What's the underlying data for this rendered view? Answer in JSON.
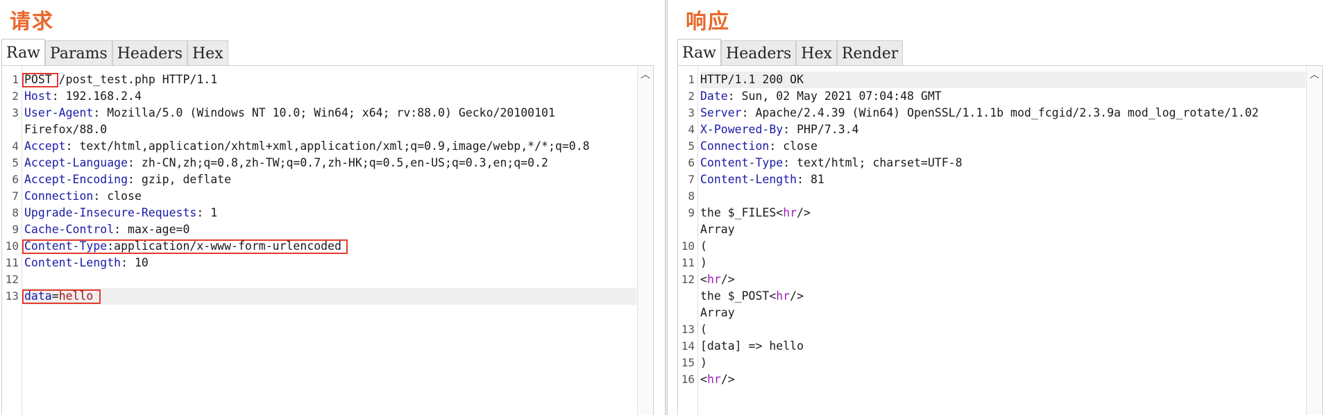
{
  "request": {
    "title": "请求",
    "tabs": [
      "Raw",
      "Params",
      "Headers",
      "Hex"
    ],
    "active_tab": "Raw",
    "lines": [
      {
        "num": "1",
        "parts": [
          {
            "t": "POST",
            "c": ""
          },
          {
            "t": " /post_test.php HTTP/1.1",
            "c": ""
          }
        ]
      },
      {
        "num": "2",
        "parts": [
          {
            "t": "Host",
            "c": "k"
          },
          {
            "t": ": 192.168.2.4",
            "c": ""
          }
        ]
      },
      {
        "num": "3",
        "parts": [
          {
            "t": "User-Agent",
            "c": "k"
          },
          {
            "t": ": Mozilla/5.0 (Windows NT 10.0; Win64; x64; rv:88.0) Gecko/20100101",
            "c": ""
          }
        ]
      },
      {
        "num": "",
        "parts": [
          {
            "t": "Firefox/88.0",
            "c": ""
          }
        ]
      },
      {
        "num": "4",
        "parts": [
          {
            "t": "Accept",
            "c": "k"
          },
          {
            "t": ": text/html,application/xhtml+xml,application/xml;q=0.9,image/webp,*/*;q=0.8",
            "c": ""
          }
        ]
      },
      {
        "num": "5",
        "parts": [
          {
            "t": "Accept-Language",
            "c": "k"
          },
          {
            "t": ": zh-CN,zh;q=0.8,zh-TW;q=0.7,zh-HK;q=0.5,en-US;q=0.3,en;q=0.2",
            "c": ""
          }
        ]
      },
      {
        "num": "6",
        "parts": [
          {
            "t": "Accept-Encoding",
            "c": "k"
          },
          {
            "t": ": gzip, deflate",
            "c": ""
          }
        ]
      },
      {
        "num": "7",
        "parts": [
          {
            "t": "Connection",
            "c": "k"
          },
          {
            "t": ": close",
            "c": ""
          }
        ]
      },
      {
        "num": "8",
        "parts": [
          {
            "t": "Upgrade-Insecure-Requests",
            "c": "k"
          },
          {
            "t": ": 1",
            "c": ""
          }
        ]
      },
      {
        "num": "9",
        "parts": [
          {
            "t": "Cache-Control",
            "c": "k"
          },
          {
            "t": ": max-age=0",
            "c": ""
          }
        ]
      },
      {
        "num": "10",
        "parts": [
          {
            "t": "Content-Type",
            "c": "k"
          },
          {
            "t": ":application/x-www-form-urlencoded",
            "c": ""
          }
        ]
      },
      {
        "num": "11",
        "parts": [
          {
            "t": "Content-Length",
            "c": "k"
          },
          {
            "t": ": 10",
            "c": ""
          }
        ]
      },
      {
        "num": "12",
        "parts": []
      },
      {
        "num": "13",
        "parts": [
          {
            "t": "data",
            "c": "k"
          },
          {
            "t": "=",
            "c": ""
          },
          {
            "t": "hello",
            "c": "v"
          }
        ],
        "highlight": true
      }
    ]
  },
  "response": {
    "title": "响应",
    "tabs": [
      "Raw",
      "Headers",
      "Hex",
      "Render"
    ],
    "active_tab": "Raw",
    "lines": [
      {
        "num": "1",
        "parts": [
          {
            "t": "HTTP/1.1 200 OK",
            "c": ""
          }
        ],
        "highlight": true
      },
      {
        "num": "2",
        "parts": [
          {
            "t": "Date",
            "c": "k"
          },
          {
            "t": ": Sun, 02 May 2021 07:04:48 GMT",
            "c": ""
          }
        ]
      },
      {
        "num": "3",
        "parts": [
          {
            "t": "Server",
            "c": "k"
          },
          {
            "t": ": Apache/2.4.39 (Win64) OpenSSL/1.1.1b mod_fcgid/2.3.9a mod_log_rotate/1.02",
            "c": ""
          }
        ]
      },
      {
        "num": "4",
        "parts": [
          {
            "t": "X-Powered-By",
            "c": "k"
          },
          {
            "t": ": PHP/7.3.4",
            "c": ""
          }
        ]
      },
      {
        "num": "5",
        "parts": [
          {
            "t": "Connection",
            "c": "k"
          },
          {
            "t": ": close",
            "c": ""
          }
        ]
      },
      {
        "num": "6",
        "parts": [
          {
            "t": "Content-Type",
            "c": "k"
          },
          {
            "t": ": text/html; charset=UTF-8",
            "c": ""
          }
        ]
      },
      {
        "num": "7",
        "parts": [
          {
            "t": "Content-Length",
            "c": "k"
          },
          {
            "t": ": 81",
            "c": ""
          }
        ]
      },
      {
        "num": "8",
        "parts": []
      },
      {
        "num": "9",
        "parts": [
          {
            "t": "the $_FILES<",
            "c": ""
          },
          {
            "t": "hr",
            "c": "tag"
          },
          {
            "t": "/>",
            "c": ""
          }
        ]
      },
      {
        "num": "",
        "parts": [
          {
            "t": "Array",
            "c": ""
          }
        ]
      },
      {
        "num": "10",
        "parts": [
          {
            "t": "(",
            "c": ""
          }
        ]
      },
      {
        "num": "11",
        "parts": [
          {
            "t": ")",
            "c": ""
          }
        ]
      },
      {
        "num": "12",
        "parts": [
          {
            "t": "<",
            "c": ""
          },
          {
            "t": "hr",
            "c": "tag"
          },
          {
            "t": "/>",
            "c": ""
          }
        ]
      },
      {
        "num": "",
        "parts": [
          {
            "t": "the $_POST<",
            "c": ""
          },
          {
            "t": "hr",
            "c": "tag"
          },
          {
            "t": "/>",
            "c": ""
          }
        ]
      },
      {
        "num": "",
        "parts": [
          {
            "t": "Array",
            "c": ""
          }
        ]
      },
      {
        "num": "13",
        "parts": [
          {
            "t": "(",
            "c": ""
          }
        ]
      },
      {
        "num": "14",
        "parts": [
          {
            "t": "[data] => hello",
            "c": ""
          }
        ]
      },
      {
        "num": "15",
        "parts": [
          {
            "t": ")",
            "c": ""
          }
        ]
      },
      {
        "num": "16",
        "parts": [
          {
            "t": "<",
            "c": ""
          },
          {
            "t": "hr",
            "c": "tag"
          },
          {
            "t": "/>",
            "c": ""
          }
        ]
      }
    ]
  },
  "colors": {
    "title": "#e8682b",
    "key": "#1a1aa6",
    "value": "#a31515",
    "tag": "#9b21b3",
    "annotation_box": "#e23a2a"
  },
  "icons": {
    "scroll_up": "scroll-up-arrow-icon"
  }
}
